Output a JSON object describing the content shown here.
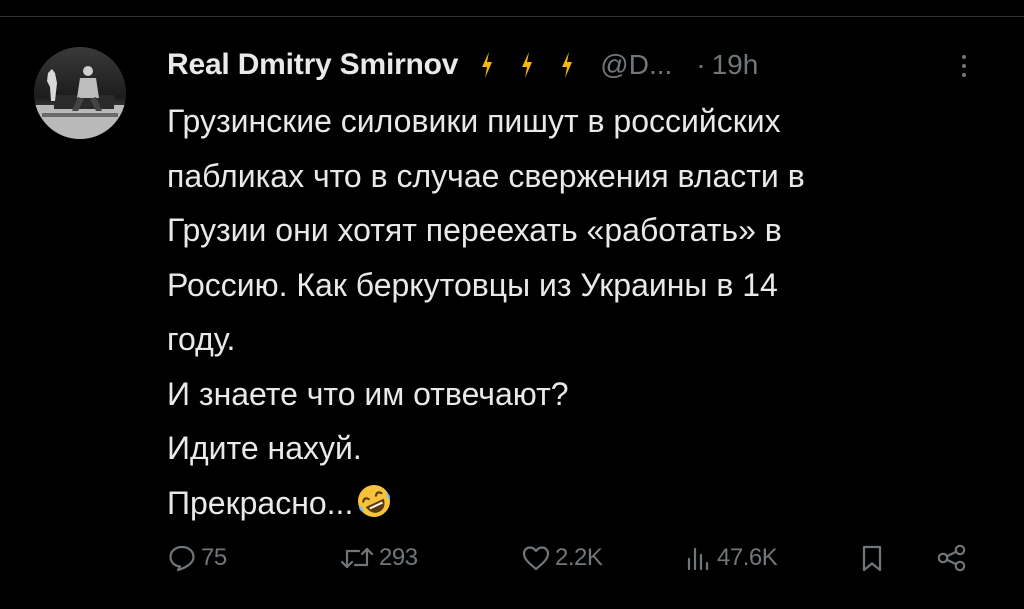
{
  "tweet": {
    "display_name": "Real Dmitry Smirnov",
    "name_badges": [
      "lightning-icon",
      "lightning-icon",
      "lightning-icon"
    ],
    "handle": "@D...",
    "separator": "·",
    "time": "19h",
    "lines": [
      "Грузинские силовики пишут в российских",
      "пабликах что в случае свержения власти в",
      "Грузии они хотят переехать «работать» в",
      "Россию. Как беркутовцы из Украины в 14",
      "году.",
      "И знаете что им отвечают?",
      "Идите нахуй.",
      "Прекрасно..."
    ],
    "last_line_emoji": "rolling-on-floor-laughing-emoji"
  },
  "actions": {
    "replies": "75",
    "reposts": "293",
    "likes": "2.2K",
    "views": "47.6K"
  },
  "icons": {
    "reply": "speech-bubble-icon",
    "repost": "repost-arrows-icon",
    "like": "heart-icon",
    "views": "bar-chart-icon",
    "bookmark": "bookmark-icon",
    "share": "share-icon",
    "more": "more-vertical-icon"
  },
  "colors": {
    "background": "#000000",
    "text": "#e7e9ea",
    "muted": "#71767b",
    "bolt": "#f4b60f"
  }
}
